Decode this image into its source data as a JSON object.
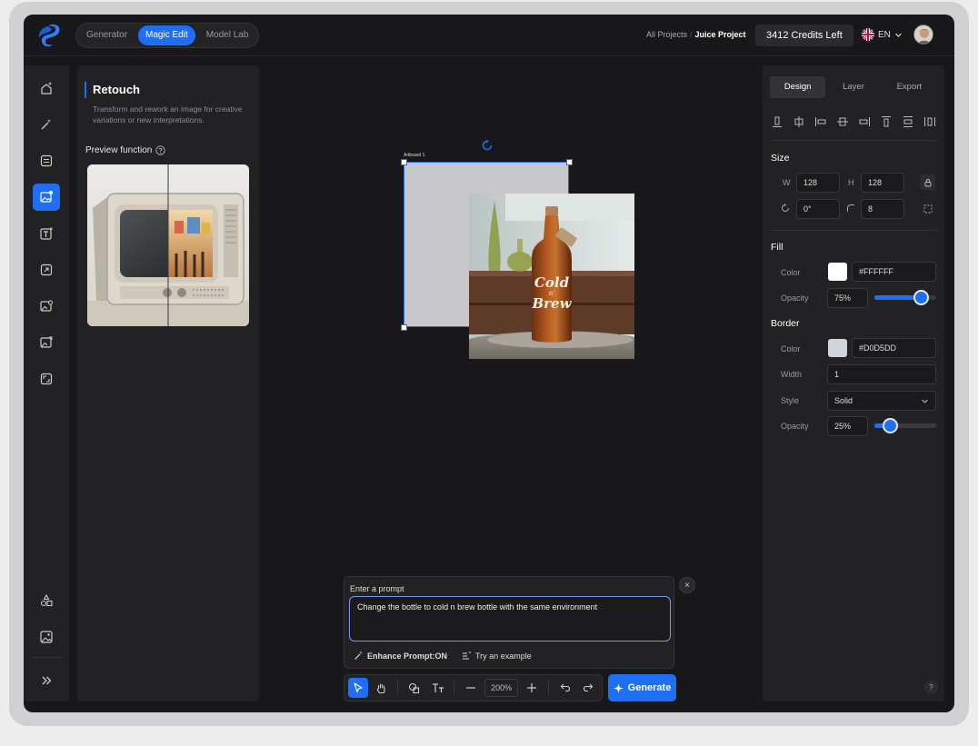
{
  "topbar": {
    "modes": [
      "Generator",
      "Magic Edit",
      "Model Lab"
    ],
    "active_mode": "Magic Edit",
    "breadcrumb_root": "All Projects",
    "breadcrumb_sep": "/",
    "breadcrumb_current": "Juice Project",
    "credits": "3412 Credits Left",
    "language": "EN"
  },
  "left_panel": {
    "title": "Retouch",
    "description": "Transform and rework an image for creative variations or new interpretations.",
    "preview_label": "Preview function"
  },
  "canvas": {
    "artboard_label": "Artboard 1",
    "bottle_text_1": "Cold",
    "bottle_text_2": "n'",
    "bottle_text_3": "Brew"
  },
  "prompt": {
    "label": "Enter a prompt",
    "value": "Change the bottle to cold n brew bottle with the same environment",
    "enhance_label": "Enhance Prompt:ON",
    "example_label": "Try an example",
    "close": "×"
  },
  "toolbar": {
    "zoom": "200%",
    "generate_label": "Generate"
  },
  "right_panel": {
    "tabs": [
      "Design",
      "Layer",
      "Export"
    ],
    "active_tab": "Design",
    "size": {
      "title": "Size",
      "w_label": "W",
      "w_value": "128",
      "h_label": "H",
      "h_value": "128",
      "rotation": "0°",
      "radius": "8"
    },
    "fill": {
      "title": "Fill",
      "color_label": "Color",
      "color_hex": "#FFFFFF",
      "opacity_label": "Opacity",
      "opacity_value": "75%",
      "opacity_fraction": 0.75
    },
    "border": {
      "title": "Border",
      "color_label": "Color",
      "color_hex": "#D0D5DD",
      "width_label": "Width",
      "width_value": "1",
      "style_label": "Style",
      "style_value": "Solid",
      "opacity_label": "Opacity",
      "opacity_value": "25%",
      "opacity_fraction": 0.25
    },
    "help": "?"
  },
  "colors": {
    "accent": "#1F6FF5",
    "background": "#18181A",
    "panel": "#222225"
  }
}
